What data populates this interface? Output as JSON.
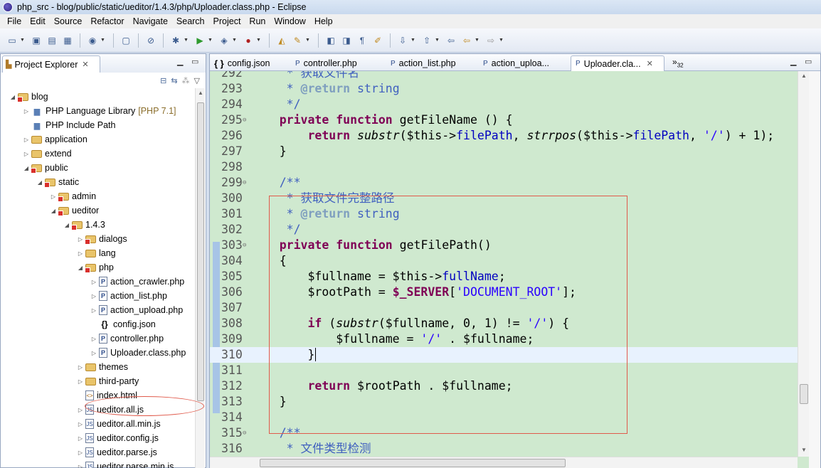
{
  "window": {
    "title": "php_src - blog/public/static/ueditor/1.4.3/php/Uploader.class.php - Eclipse"
  },
  "menu": [
    "File",
    "Edit",
    "Source",
    "Refactor",
    "Navigate",
    "Search",
    "Project",
    "Run",
    "Window",
    "Help"
  ],
  "explorer": {
    "tab_label": "Project Explorer",
    "tree": [
      {
        "label": "blog",
        "depth": 0,
        "icon": "project-icon",
        "twisty": "expanded",
        "error": true
      },
      {
        "label": "PHP Language Library",
        "decor": "[PHP 7.1]",
        "depth": 1,
        "icon": "library-icon",
        "twisty": "collapsed"
      },
      {
        "label": "PHP Include Path",
        "depth": 1,
        "icon": "library-icon",
        "twisty": ""
      },
      {
        "label": "application",
        "depth": 1,
        "icon": "folder-icon",
        "twisty": "collapsed"
      },
      {
        "label": "extend",
        "depth": 1,
        "icon": "folder-icon",
        "twisty": "collapsed"
      },
      {
        "label": "public",
        "depth": 1,
        "icon": "folder-icon",
        "twisty": "expanded",
        "error": true
      },
      {
        "label": "static",
        "depth": 2,
        "icon": "folder-icon",
        "twisty": "expanded",
        "error": true
      },
      {
        "label": "admin",
        "depth": 3,
        "icon": "folder-icon",
        "twisty": "collapsed",
        "error": true
      },
      {
        "label": "ueditor",
        "depth": 3,
        "icon": "folder-icon",
        "twisty": "expanded",
        "error": true
      },
      {
        "label": "1.4.3",
        "depth": 4,
        "icon": "folder-icon",
        "twisty": "expanded",
        "error": true
      },
      {
        "label": "dialogs",
        "depth": 5,
        "icon": "folder-icon",
        "twisty": "collapsed",
        "error": true
      },
      {
        "label": "lang",
        "depth": 5,
        "icon": "folder-icon",
        "twisty": "collapsed"
      },
      {
        "label": "php",
        "depth": 5,
        "icon": "folder-icon",
        "twisty": "expanded",
        "error": true
      },
      {
        "label": "action_crawler.php",
        "depth": 6,
        "icon": "php-file-icon",
        "twisty": "collapsed"
      },
      {
        "label": "action_list.php",
        "depth": 6,
        "icon": "php-file-icon",
        "twisty": "collapsed"
      },
      {
        "label": "action_upload.php",
        "depth": 6,
        "icon": "php-file-icon",
        "twisty": "collapsed"
      },
      {
        "label": "config.json",
        "depth": 6,
        "icon": "json-file-icon",
        "twisty": ""
      },
      {
        "label": "controller.php",
        "depth": 6,
        "icon": "php-file-icon",
        "twisty": "collapsed"
      },
      {
        "label": "Uploader.class.php",
        "depth": 6,
        "icon": "php-file-icon",
        "twisty": "collapsed"
      },
      {
        "label": "themes",
        "depth": 5,
        "icon": "folder-icon",
        "twisty": "collapsed"
      },
      {
        "label": "third-party",
        "depth": 5,
        "icon": "folder-icon",
        "twisty": "collapsed"
      },
      {
        "label": "index.html",
        "depth": 5,
        "icon": "html-file-icon",
        "twisty": ""
      },
      {
        "label": "ueditor.all.js",
        "depth": 5,
        "icon": "js-file-icon",
        "twisty": "collapsed"
      },
      {
        "label": "ueditor.all.min.js",
        "depth": 5,
        "icon": "js-file-icon",
        "twisty": "collapsed"
      },
      {
        "label": "ueditor.config.js",
        "depth": 5,
        "icon": "js-file-icon",
        "twisty": "collapsed"
      },
      {
        "label": "ueditor.parse.js",
        "depth": 5,
        "icon": "js-file-icon",
        "twisty": "collapsed"
      },
      {
        "label": "ueditor.parse.min.js",
        "depth": 5,
        "icon": "js-file-icon",
        "twisty": "collapsed"
      }
    ]
  },
  "editor": {
    "tabs": [
      {
        "label": "config.json",
        "icon": "json-file-icon",
        "active": false
      },
      {
        "label": "controller.php",
        "icon": "php-file-icon",
        "active": false
      },
      {
        "label": "action_list.php",
        "icon": "php-file-icon",
        "active": false
      },
      {
        "label": "action_uploa...",
        "icon": "php-file-icon",
        "active": false
      },
      {
        "label": "Uploader.cla...",
        "icon": "php-file-icon",
        "active": true
      }
    ],
    "overflow_count": "32",
    "current_line": "310",
    "lines": [
      {
        "num": "292",
        "fold": "",
        "segs": [
          [
            "cm",
            "     * 获取文件名"
          ]
        ]
      },
      {
        "num": "293",
        "fold": "",
        "segs": [
          [
            "cm",
            "     * "
          ],
          [
            "tag",
            "@return"
          ],
          [
            "cm",
            " string"
          ]
        ]
      },
      {
        "num": "294",
        "fold": "",
        "segs": [
          [
            "cm",
            "     */"
          ]
        ]
      },
      {
        "num": "295",
        "fold": "⊖",
        "segs": [
          [
            "",
            "    "
          ],
          [
            "kw",
            "private"
          ],
          [
            "",
            " "
          ],
          [
            "kw",
            "function"
          ],
          [
            "",
            " getFileName () {"
          ]
        ]
      },
      {
        "num": "296",
        "fold": "",
        "segs": [
          [
            "",
            "        "
          ],
          [
            "kw",
            "return"
          ],
          [
            "",
            " "
          ],
          [
            "fn-i",
            "substr"
          ],
          [
            "",
            "($this->"
          ],
          [
            "prop",
            "filePath"
          ],
          [
            "",
            ", "
          ],
          [
            "fn-i",
            "strrpos"
          ],
          [
            "",
            "($this->"
          ],
          [
            "prop",
            "filePath"
          ],
          [
            "",
            ", "
          ],
          [
            "str",
            "'/'"
          ],
          [
            "",
            ") + 1);"
          ]
        ]
      },
      {
        "num": "297",
        "fold": "",
        "segs": [
          [
            "",
            "    }"
          ]
        ]
      },
      {
        "num": "298",
        "fold": "",
        "segs": [
          [
            "",
            ""
          ]
        ]
      },
      {
        "num": "299",
        "fold": "⊖",
        "segs": [
          [
            "cm",
            "    /**"
          ]
        ]
      },
      {
        "num": "300",
        "fold": "",
        "segs": [
          [
            "cm",
            "     * 获取文件完整路径"
          ]
        ]
      },
      {
        "num": "301",
        "fold": "",
        "segs": [
          [
            "cm",
            "     * "
          ],
          [
            "tag",
            "@return"
          ],
          [
            "cm",
            " string"
          ]
        ]
      },
      {
        "num": "302",
        "fold": "",
        "segs": [
          [
            "cm",
            "     */"
          ]
        ]
      },
      {
        "num": "303",
        "fold": "⊖",
        "segs": [
          [
            "",
            "    "
          ],
          [
            "kw",
            "private"
          ],
          [
            "",
            " "
          ],
          [
            "kw",
            "function"
          ],
          [
            "",
            " getFilePath()"
          ]
        ]
      },
      {
        "num": "304",
        "fold": "",
        "segs": [
          [
            "",
            "    {"
          ]
        ]
      },
      {
        "num": "305",
        "fold": "",
        "segs": [
          [
            "",
            "        $fullname = $this->"
          ],
          [
            "prop",
            "fullName"
          ],
          [
            "",
            ";"
          ]
        ]
      },
      {
        "num": "306",
        "fold": "",
        "segs": [
          [
            "",
            "        $rootPath = "
          ],
          [
            "glob",
            "$_SERVER"
          ],
          [
            "",
            "["
          ],
          [
            "str",
            "'DOCUMENT_ROOT'"
          ],
          [
            "",
            "];"
          ]
        ]
      },
      {
        "num": "307",
        "fold": "",
        "segs": [
          [
            "",
            ""
          ]
        ]
      },
      {
        "num": "308",
        "fold": "",
        "segs": [
          [
            "",
            "        "
          ],
          [
            "kw",
            "if"
          ],
          [
            "",
            " ("
          ],
          [
            "fn-i",
            "substr"
          ],
          [
            "",
            "($fullname, 0, 1) != "
          ],
          [
            "str",
            "'/'"
          ],
          [
            "",
            ") {"
          ]
        ]
      },
      {
        "num": "309",
        "fold": "",
        "segs": [
          [
            "",
            "            $fullname = "
          ],
          [
            "str",
            "'/'"
          ],
          [
            "",
            " . $fullname;"
          ]
        ]
      },
      {
        "num": "310",
        "fold": "",
        "segs": [
          [
            "",
            "        }"
          ]
        ]
      },
      {
        "num": "311",
        "fold": "",
        "segs": [
          [
            "",
            ""
          ]
        ]
      },
      {
        "num": "312",
        "fold": "",
        "segs": [
          [
            "",
            "        "
          ],
          [
            "kw",
            "return"
          ],
          [
            "",
            " $rootPath . $fullname;"
          ]
        ]
      },
      {
        "num": "313",
        "fold": "",
        "segs": [
          [
            "",
            "    }"
          ]
        ]
      },
      {
        "num": "314",
        "fold": "",
        "segs": [
          [
            "",
            ""
          ]
        ]
      },
      {
        "num": "315",
        "fold": "⊖",
        "segs": [
          [
            "cm",
            "    /**"
          ]
        ]
      },
      {
        "num": "316",
        "fold": "",
        "segs": [
          [
            "cm",
            "     * 文件类型检测"
          ]
        ]
      }
    ]
  }
}
